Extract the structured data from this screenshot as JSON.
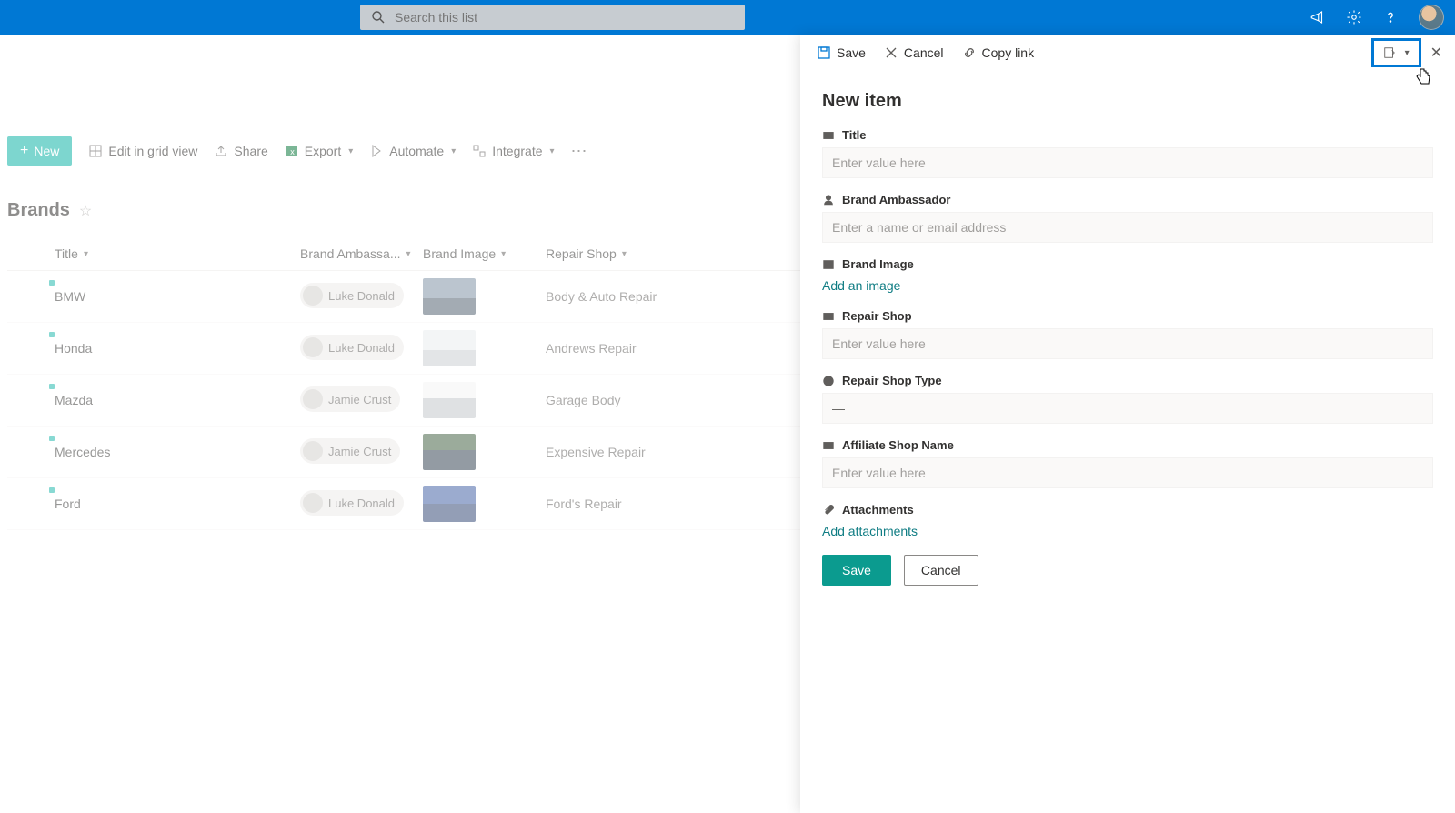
{
  "topbar": {
    "search_placeholder": "Search this list"
  },
  "toolbar": {
    "new": "New",
    "edit_grid": "Edit in grid view",
    "share": "Share",
    "export": "Export",
    "automate": "Automate",
    "integrate": "Integrate"
  },
  "list": {
    "title": "Brands",
    "columns": {
      "title": "Title",
      "ambassador": "Brand Ambassa...",
      "image": "Brand Image",
      "repair": "Repair Shop"
    },
    "rows": [
      {
        "title": "BMW",
        "ambassador": "Luke Donald",
        "thumb_class": "car-bmw",
        "repair": "Body & Auto Repair"
      },
      {
        "title": "Honda",
        "ambassador": "Luke Donald",
        "thumb_class": "car-honda",
        "repair": "Andrews Repair"
      },
      {
        "title": "Mazda",
        "ambassador": "Jamie Crust",
        "thumb_class": "car-mazda",
        "repair": "Garage Body"
      },
      {
        "title": "Mercedes",
        "ambassador": "Jamie Crust",
        "thumb_class": "car-merc",
        "repair": "Expensive Repair"
      },
      {
        "title": "Ford",
        "ambassador": "Luke Donald",
        "thumb_class": "car-ford",
        "repair": "Ford's Repair"
      }
    ]
  },
  "panel": {
    "bar": {
      "save": "Save",
      "cancel": "Cancel",
      "copy": "Copy link"
    },
    "title": "New item",
    "fields": {
      "title_label": "Title",
      "title_ph": "Enter value here",
      "amb_label": "Brand Ambassador",
      "amb_ph": "Enter a name or email address",
      "img_label": "Brand Image",
      "img_action": "Add an image",
      "repair_label": "Repair Shop",
      "repair_ph": "Enter value here",
      "type_label": "Repair Shop Type",
      "type_value": "—",
      "aff_label": "Affiliate Shop Name",
      "aff_ph": "Enter value here",
      "att_label": "Attachments",
      "att_action": "Add attachments"
    },
    "actions": {
      "save": "Save",
      "cancel": "Cancel"
    }
  }
}
